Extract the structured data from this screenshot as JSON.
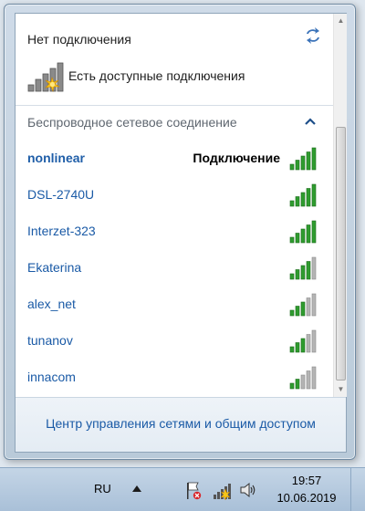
{
  "header": {
    "status": "Нет подключения",
    "available": "Есть доступные подключения"
  },
  "section": {
    "title": "Беспроводное сетевое соединение"
  },
  "networks": [
    {
      "name": "nonlinear",
      "status": "Подключение",
      "signal": 5
    },
    {
      "name": "DSL-2740U",
      "status": "",
      "signal": 5
    },
    {
      "name": "Interzet-323",
      "status": "",
      "signal": 5
    },
    {
      "name": "Ekaterina",
      "status": "",
      "signal": 4
    },
    {
      "name": "alex_net",
      "status": "",
      "signal": 3
    },
    {
      "name": "tunanov",
      "status": "",
      "signal": 3
    },
    {
      "name": "innacom",
      "status": "",
      "signal": 2
    }
  ],
  "footer": {
    "link": "Центр управления сетями и общим доступом"
  },
  "taskbar": {
    "language": "RU",
    "time": "19:57",
    "date": "10.06.2019"
  },
  "colors": {
    "bar_active": "#2f9c2f",
    "bar_inactive": "#b4b4b4",
    "link": "#1a5aa6"
  }
}
